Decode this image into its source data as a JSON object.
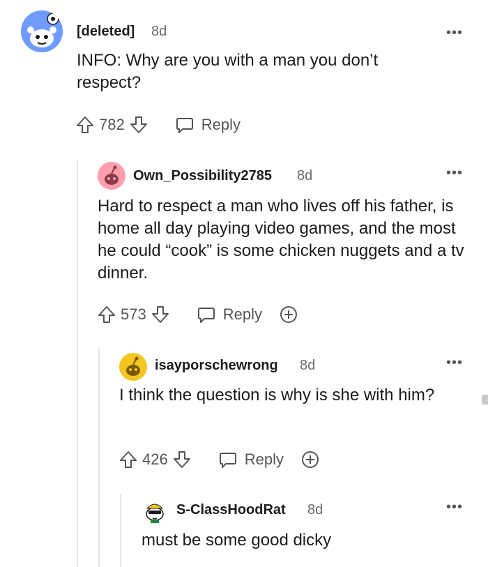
{
  "comments": [
    {
      "username": "[deleted]",
      "age": "8d",
      "more": "•••",
      "body": "INFO: Why are you with a man you don’t respect?",
      "score": "782",
      "reply_label": "Reply",
      "avatar_color": "#6f9bff"
    },
    {
      "username": "Own_Possibility2785",
      "age": "8d",
      "more": "•••",
      "body": "Hard to respect a man who lives off his father, is home all day playing video games, and the most he could “cook” is some chicken nuggets and a tv dinner.",
      "score": "573",
      "reply_label": "Reply",
      "avatar_color": "#ff9fae"
    },
    {
      "username": "isayporschewrong",
      "age": "8d",
      "more": "•••",
      "body": "I think the question is why is she with him?",
      "score": "426",
      "reply_label": "Reply",
      "avatar_color": "#f3c623"
    },
    {
      "username": "S-ClassHoodRat",
      "age": "8d",
      "more": "•••",
      "body": "must be some good dicky",
      "avatar_color": "#ffffff"
    }
  ],
  "icons": {
    "upvote": "upvote-arrow-icon",
    "downvote": "downvote-arrow-icon",
    "reply": "speech-bubble-icon",
    "award": "plus-circle-icon",
    "more": "overflow-dots-icon"
  }
}
